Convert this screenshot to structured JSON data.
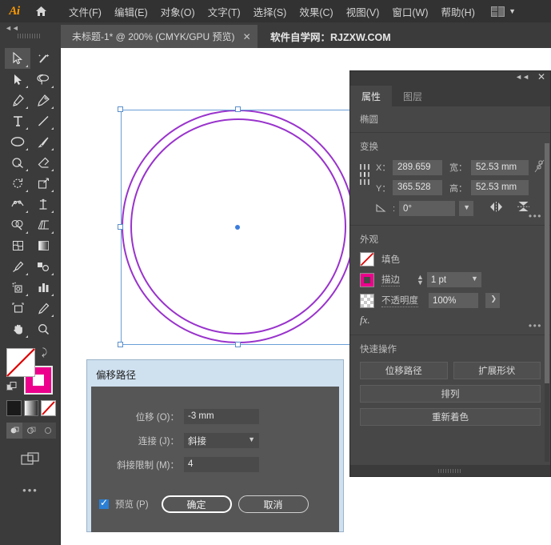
{
  "app": {
    "logo_text": "Ai",
    "home_icon": "home-icon"
  },
  "menubar": {
    "items": [
      {
        "label": "文件(F)"
      },
      {
        "label": "编辑(E)"
      },
      {
        "label": "对象(O)"
      },
      {
        "label": "文字(T)"
      },
      {
        "label": "选择(S)"
      },
      {
        "label": "效果(C)"
      },
      {
        "label": "视图(V)"
      },
      {
        "label": "窗口(W)"
      },
      {
        "label": "帮助(H)"
      }
    ],
    "workspace_icon": "workspace-switcher-icon",
    "workspace_chevron": "▼"
  },
  "tabbar": {
    "collapse_icon": "◄◄",
    "document_tab": {
      "label": "未标题-1* @ 200% (CMYK/GPU 预览)",
      "close": "✕"
    },
    "site_label": "软件自学网：RJZXW.COM"
  },
  "toolbar": {
    "tools": [
      {
        "name": "selection-tool",
        "active": true
      },
      {
        "name": "magic-wand-tool",
        "active": false
      },
      {
        "name": "direct-selection-tool",
        "active": false
      },
      {
        "name": "lasso-tool",
        "active": false
      },
      {
        "name": "pen-tool",
        "active": false
      },
      {
        "name": "curvature-tool",
        "active": false
      },
      {
        "name": "type-tool",
        "active": false
      },
      {
        "name": "line-segment-tool",
        "active": false
      },
      {
        "name": "ellipse-tool",
        "active": false
      },
      {
        "name": "paintbrush-tool",
        "active": false
      },
      {
        "name": "shaper-tool",
        "active": false
      },
      {
        "name": "eraser-tool",
        "active": false
      },
      {
        "name": "rotate-tool",
        "active": false
      },
      {
        "name": "scale-tool",
        "active": false
      },
      {
        "name": "width-tool",
        "active": false
      },
      {
        "name": "free-transform-tool",
        "active": false
      },
      {
        "name": "shape-builder-tool",
        "active": false
      },
      {
        "name": "perspective-grid-tool",
        "active": false
      },
      {
        "name": "mesh-tool",
        "active": false
      },
      {
        "name": "gradient-tool",
        "active": false
      },
      {
        "name": "eyedropper-tool",
        "active": false
      },
      {
        "name": "blend-tool",
        "active": false
      },
      {
        "name": "symbol-sprayer-tool",
        "active": false
      },
      {
        "name": "column-graph-tool",
        "active": false
      },
      {
        "name": "artboard-tool",
        "active": false
      },
      {
        "name": "slice-tool",
        "active": false
      },
      {
        "name": "hand-tool",
        "active": false
      },
      {
        "name": "zoom-tool",
        "active": false
      }
    ],
    "fill_color": "#ffffff",
    "fill_none": true,
    "stroke_color": "#ec008c",
    "swap_icon": "swap-fill-stroke-icon",
    "mode_buttons": [
      "color-swatch-black",
      "gradient-swatch",
      "none-swatch"
    ],
    "draw_modes": [
      "draw-normal",
      "draw-behind",
      "draw-inside"
    ],
    "screen_mode_icon": "screen-mode-icon",
    "more_tools": "•••"
  },
  "canvas": {
    "shape": "two-concentric-circles",
    "stroke_color": "#9933cc",
    "selection_color": "#6a9fd8"
  },
  "panel": {
    "collapse_icon": "◄◄",
    "close_icon": "✕",
    "tabs": [
      {
        "label": "属性",
        "active": true
      },
      {
        "label": "图层",
        "active": false
      }
    ],
    "object_type": "椭圆",
    "transform": {
      "title": "变换",
      "x_label": "X：",
      "x_value": "289.659",
      "y_label": "Y：",
      "y_value": "365.528",
      "w_label": "宽：",
      "w_value": "52.53 mm",
      "h_label": "高：",
      "h_value": "52.53 mm",
      "link_icon": "link-broken-icon",
      "angle_label": "angle-icon",
      "angle_value": "0°",
      "flip_h_icon": "flip-horizontal-icon",
      "flip_v_icon": "flip-vertical-icon",
      "more_icon": "•••"
    },
    "appearance": {
      "title": "外观",
      "fill_label": "填色",
      "fill_swatch": "none-swatch",
      "stroke_label": "描边",
      "stroke_swatch": "#ec008c",
      "stroke_width": "1 pt",
      "stroke_chevron": "▼",
      "opacity_label": "不透明度",
      "opacity_value": "100%",
      "opacity_chevron": "❯",
      "fx_label": "fx.",
      "more_icon": "•••"
    },
    "quick_actions": {
      "title": "快速操作",
      "buttons": [
        {
          "label": "位移路径"
        },
        {
          "label": "扩展形状"
        },
        {
          "label": "排列"
        },
        {
          "label": "重新着色"
        }
      ]
    }
  },
  "dialog": {
    "title": "偏移路径",
    "offset_label": "位移 (O)：",
    "offset_value": "-3 mm",
    "join_label": "连接 (J)：",
    "join_value": "斜接",
    "join_chevron": "▼",
    "miter_label": "斜接限制 (M)：",
    "miter_value": "4",
    "preview_label": "预览 (P)",
    "preview_checked": true,
    "ok_label": "确定",
    "cancel_label": "取消"
  }
}
